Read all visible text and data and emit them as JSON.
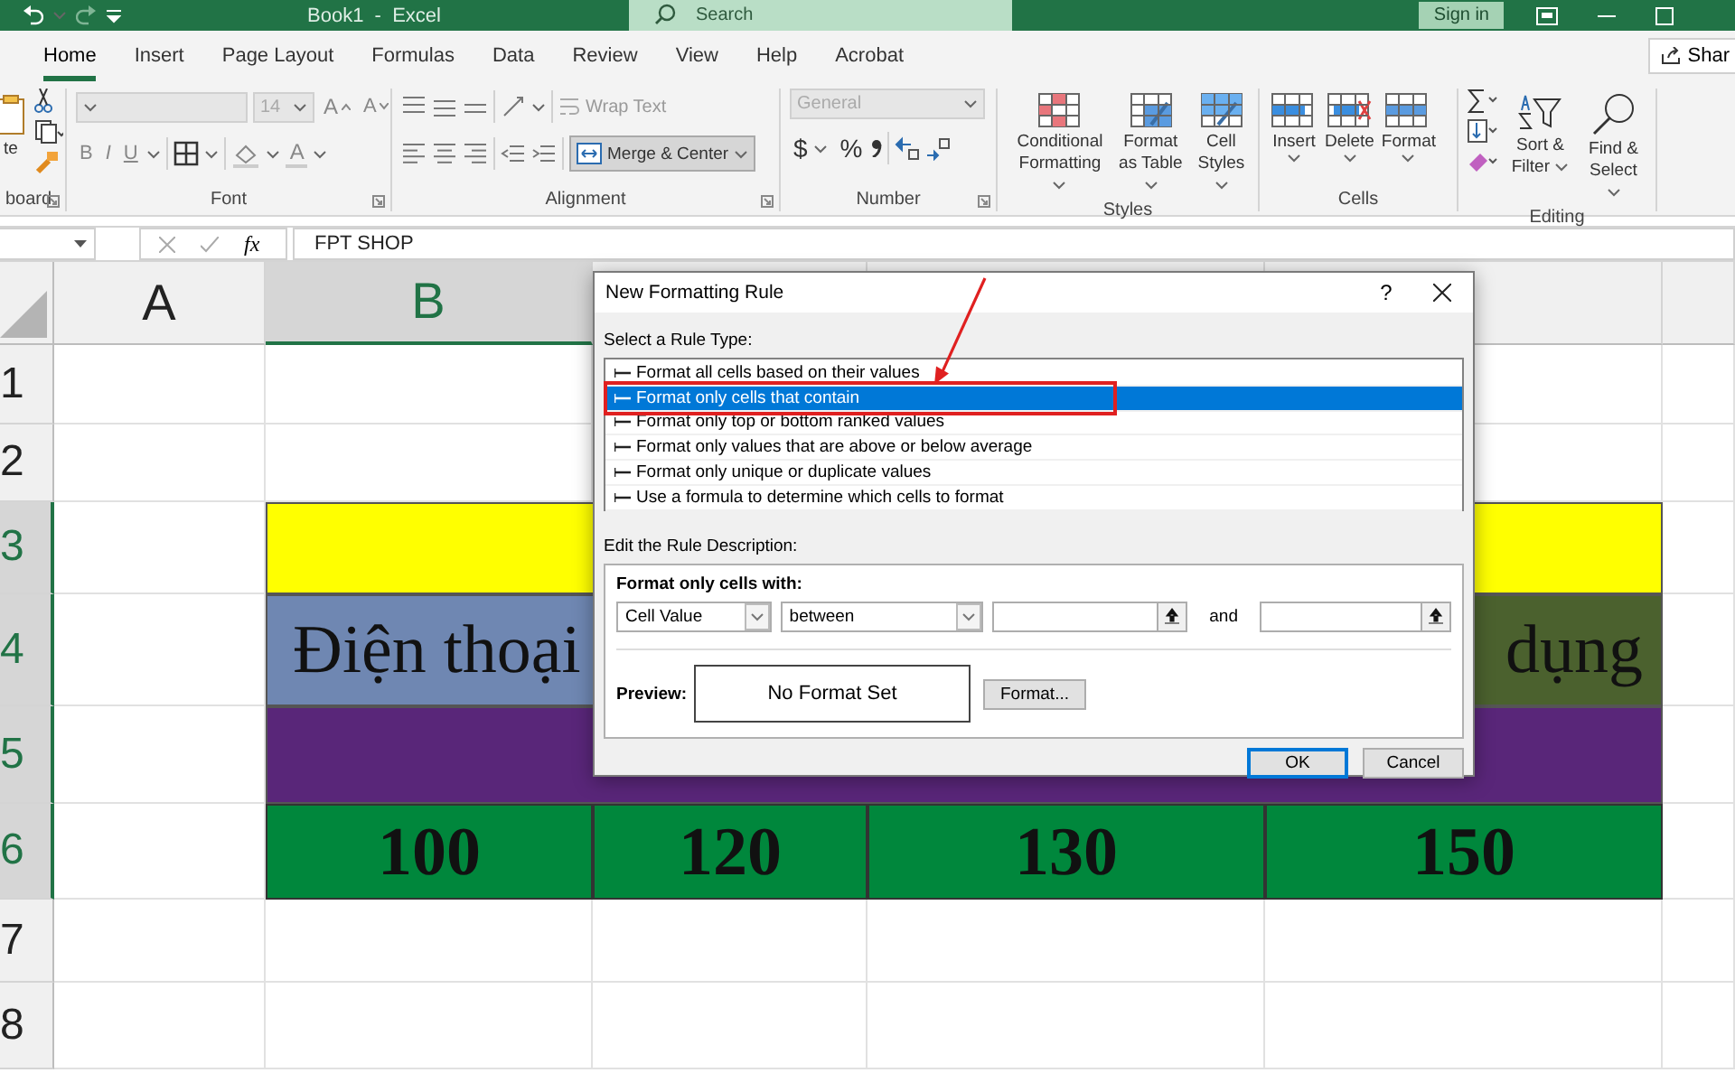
{
  "title_bar": {
    "title": "Book1  -  Excel",
    "search": {
      "placeholder": "Search"
    },
    "sign_in": "Sign in"
  },
  "tabs": [
    {
      "label": "Home",
      "selected": true
    },
    {
      "label": "Insert",
      "selected": false
    },
    {
      "label": "Page Layout",
      "selected": false
    },
    {
      "label": "Formulas",
      "selected": false
    },
    {
      "label": "Data",
      "selected": false
    },
    {
      "label": "Review",
      "selected": false
    },
    {
      "label": "View",
      "selected": false
    },
    {
      "label": "Help",
      "selected": false
    },
    {
      "label": "Acrobat",
      "selected": false
    }
  ],
  "share": "Shar",
  "ribbon": {
    "clipboard": {
      "label": "board",
      "paste": "te"
    },
    "font": {
      "label": "Font",
      "size": "14",
      "size_buttons": [
        "A",
        "A"
      ],
      "toggles": [
        "B",
        "I",
        "U"
      ],
      "color_letter": "A"
    },
    "alignment": {
      "label": "Alignment",
      "wrap_text": "Wrap Text",
      "merge": {
        "label": "Merge & Center",
        "on": true
      }
    },
    "number": {
      "label": "Number",
      "format": "General",
      "symbols": [
        "$",
        "%"
      ]
    },
    "styles": {
      "label": "Styles",
      "buttons": [
        "Conditional Formatting",
        "Format as Table",
        "Cell Styles"
      ]
    },
    "cells": {
      "label": "Cells",
      "buttons": [
        "Insert",
        "Delete",
        "Format"
      ]
    },
    "editing": {
      "label": "Editing",
      "buttons": [
        "Sort & Filter",
        "Find & Select"
      ]
    }
  },
  "formula_bar": {
    "function_label": "fx",
    "value": "FPT SHOP"
  },
  "sheet": {
    "columns": [
      {
        "label": "A",
        "selected": false
      },
      {
        "label": "B",
        "selected": true
      }
    ],
    "rows": [
      {
        "label": "1",
        "selected": false
      },
      {
        "label": "2",
        "selected": false
      },
      {
        "label": "3",
        "selected": true
      },
      {
        "label": "4",
        "selected": true
      },
      {
        "label": "5",
        "selected": true
      },
      {
        "label": "6",
        "selected": true
      },
      {
        "label": "7",
        "selected": false
      },
      {
        "label": "8",
        "selected": false
      }
    ],
    "bands": [
      {
        "kind": "blank",
        "color": "#ffff00"
      },
      {
        "kind": "split",
        "left": {
          "text": "Điện thoại",
          "color": "#6f87b2"
        },
        "right": {
          "text": "dụng",
          "color": "#4b612e"
        }
      },
      {
        "kind": "blank",
        "color": "#592679"
      },
      {
        "kind": "values",
        "color": "#00873c",
        "values": [
          "100",
          "120",
          "130",
          "150"
        ]
      }
    ]
  },
  "dialog": {
    "title": "New Formatting Rule",
    "help": "?",
    "rule_type_label": "Select a Rule Type:",
    "rule_types": [
      {
        "label": "Format all cells based on their values",
        "selected": false,
        "annotated": false
      },
      {
        "label": "Format only cells that contain",
        "selected": true,
        "annotated": true
      },
      {
        "label": "Format only top or bottom ranked values",
        "selected": false,
        "annotated": false
      },
      {
        "label": "Format only values that are above or below average",
        "selected": false,
        "annotated": false
      },
      {
        "label": "Format only unique or duplicate values",
        "selected": false,
        "annotated": false
      },
      {
        "label": "Use a formula to determine which cells to format",
        "selected": false,
        "annotated": false
      }
    ],
    "description_label": "Edit the Rule Description:",
    "condition_label": "Format only cells with:",
    "subject": "Cell Value",
    "operator": "between",
    "joiner": "and",
    "preview_label": "Preview:",
    "preview": "No Format Set",
    "format_button": "Format...",
    "ok": "OK",
    "cancel": "Cancel"
  }
}
